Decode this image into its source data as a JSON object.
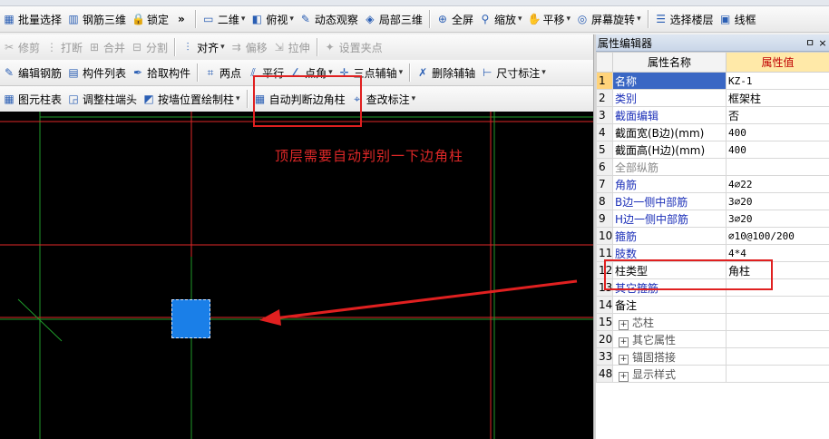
{
  "toolbar1": [
    {
      "label": "批量选择",
      "icon": "batch-select-icon",
      "glyph": "▦"
    },
    {
      "label": "钢筋三维",
      "icon": "rebar-3d-icon",
      "glyph": "▥"
    },
    {
      "label": "锁定",
      "icon": "lock-icon",
      "glyph": "🔒"
    },
    {
      "label": "»",
      "icon": "more-icon",
      "glyph": ""
    },
    {
      "label": "二维",
      "icon": "2d-view-icon",
      "glyph": "▭",
      "dropdown": true
    },
    {
      "label": "俯视",
      "icon": "top-view-icon",
      "glyph": "◧",
      "dropdown": true
    },
    {
      "label": "动态观察",
      "icon": "orbit-icon",
      "glyph": "✎"
    },
    {
      "label": "局部三维",
      "icon": "partial-3d-icon",
      "glyph": "◈"
    },
    {
      "label": "全屏",
      "icon": "fullscreen-icon",
      "glyph": "⊕"
    },
    {
      "label": "缩放",
      "icon": "zoom-icon",
      "glyph": "⚲",
      "dropdown": true
    },
    {
      "label": "平移",
      "icon": "pan-icon",
      "glyph": "✋",
      "dropdown": true
    },
    {
      "label": "屏幕旋转",
      "icon": "rotate-screen-icon",
      "glyph": "◎",
      "dropdown": true
    },
    {
      "label": "选择楼层",
      "icon": "select-floor-icon",
      "glyph": "☰"
    },
    {
      "label": "线框",
      "icon": "wireframe-icon",
      "glyph": "▣"
    }
  ],
  "toolbar2": [
    {
      "label": "修剪",
      "icon": "trim-icon",
      "glyph": "✂",
      "disabled": true
    },
    {
      "label": "打断",
      "icon": "break-icon",
      "glyph": "⋮",
      "disabled": true
    },
    {
      "label": "合并",
      "icon": "merge-icon",
      "glyph": "⊞",
      "disabled": true
    },
    {
      "label": "分割",
      "icon": "split-icon",
      "glyph": "⊟",
      "disabled": true
    },
    {
      "label": "对齐",
      "icon": "align-icon",
      "glyph": "⫶",
      "dropdown": true
    },
    {
      "label": "偏移",
      "icon": "offset-icon",
      "glyph": "⇉",
      "disabled": true
    },
    {
      "label": "拉伸",
      "icon": "stretch-icon",
      "glyph": "⇲",
      "disabled": true
    },
    {
      "label": "设置夹点",
      "icon": "grip-icon",
      "glyph": "✦",
      "disabled": true
    }
  ],
  "toolbar3": [
    {
      "label": "编辑钢筋",
      "icon": "edit-rebar-icon",
      "glyph": "✎"
    },
    {
      "label": "构件列表",
      "icon": "component-list-icon",
      "glyph": "▤"
    },
    {
      "label": "拾取构件",
      "icon": "pick-component-icon",
      "glyph": "✒"
    },
    {
      "label": "两点",
      "icon": "two-point-icon",
      "glyph": "⌗"
    },
    {
      "label": "平行",
      "icon": "parallel-icon",
      "glyph": "⫽"
    },
    {
      "label": "点角",
      "icon": "point-angle-icon",
      "glyph": "∠",
      "dropdown": true
    },
    {
      "label": "三点辅轴",
      "icon": "three-point-axis-icon",
      "glyph": "✛",
      "dropdown": true
    },
    {
      "label": "删除辅轴",
      "icon": "delete-axis-icon",
      "glyph": "✗"
    },
    {
      "label": "尺寸标注",
      "icon": "dimension-icon",
      "glyph": "⊢",
      "dropdown": true
    }
  ],
  "toolbar4": [
    {
      "label": "图元柱表",
      "icon": "column-table-icon",
      "glyph": "▦"
    },
    {
      "label": "调整柱端头",
      "icon": "adjust-column-end-icon",
      "glyph": "◲"
    },
    {
      "label": "按墙位置绘制柱",
      "icon": "draw-column-by-wall-icon",
      "glyph": "◩",
      "dropdown": true
    },
    {
      "label": "自动判断边角柱",
      "icon": "auto-corner-column-icon",
      "glyph": "▦"
    },
    {
      "label": "查改标注",
      "icon": "check-annotation-icon",
      "glyph": "⌖",
      "dropdown": true
    }
  ],
  "canvas": {
    "annotation": "顶层需要自动判别一下边角柱",
    "colors": {
      "red_axis": "#e02828",
      "green_axis": "#1f9a2a",
      "column": "#1a7fe8"
    }
  },
  "panel": {
    "title": "属性编辑器",
    "pin": "ㅁ",
    "close": "×",
    "header_name": "属性名称",
    "header_value": "属性值",
    "rows": [
      {
        "no": "1",
        "name": "名称",
        "value": "KZ-1",
        "style": "blue",
        "selected": true
      },
      {
        "no": "2",
        "name": "类别",
        "value": "框架柱",
        "style": "blue",
        "cn": true
      },
      {
        "no": "3",
        "name": "截面编辑",
        "value": "否",
        "style": "blue",
        "cn": true
      },
      {
        "no": "4",
        "name": "截面宽(B边)(mm)",
        "value": "400",
        "style": "black"
      },
      {
        "no": "5",
        "name": "截面高(H边)(mm)",
        "value": "400",
        "style": "black"
      },
      {
        "no": "6",
        "name": "全部纵筋",
        "value": "",
        "style": "gray"
      },
      {
        "no": "7",
        "name": "角筋",
        "value": "4⌀22",
        "style": "blue"
      },
      {
        "no": "8",
        "name": "B边一侧中部筋",
        "value": "3⌀20",
        "style": "blue"
      },
      {
        "no": "9",
        "name": "H边一侧中部筋",
        "value": "3⌀20",
        "style": "blue"
      },
      {
        "no": "10",
        "name": "箍筋",
        "value": "⌀10@100/200",
        "style": "blue"
      },
      {
        "no": "11",
        "name": "肢数",
        "value": "4*4",
        "style": "blue"
      },
      {
        "no": "12",
        "name": "柱类型",
        "value": "角柱",
        "style": "black",
        "cn": true
      },
      {
        "no": "13",
        "name": "其它箍筋",
        "value": "",
        "style": "blue"
      },
      {
        "no": "14",
        "name": "备注",
        "value": "",
        "style": "black"
      },
      {
        "no": "15",
        "name": "芯柱",
        "value": "",
        "group": true
      },
      {
        "no": "20",
        "name": "其它属性",
        "value": "",
        "group": true
      },
      {
        "no": "33",
        "name": "锚固搭接",
        "value": "",
        "group": true
      },
      {
        "no": "48",
        "name": "显示样式",
        "value": "",
        "group": true
      }
    ]
  }
}
